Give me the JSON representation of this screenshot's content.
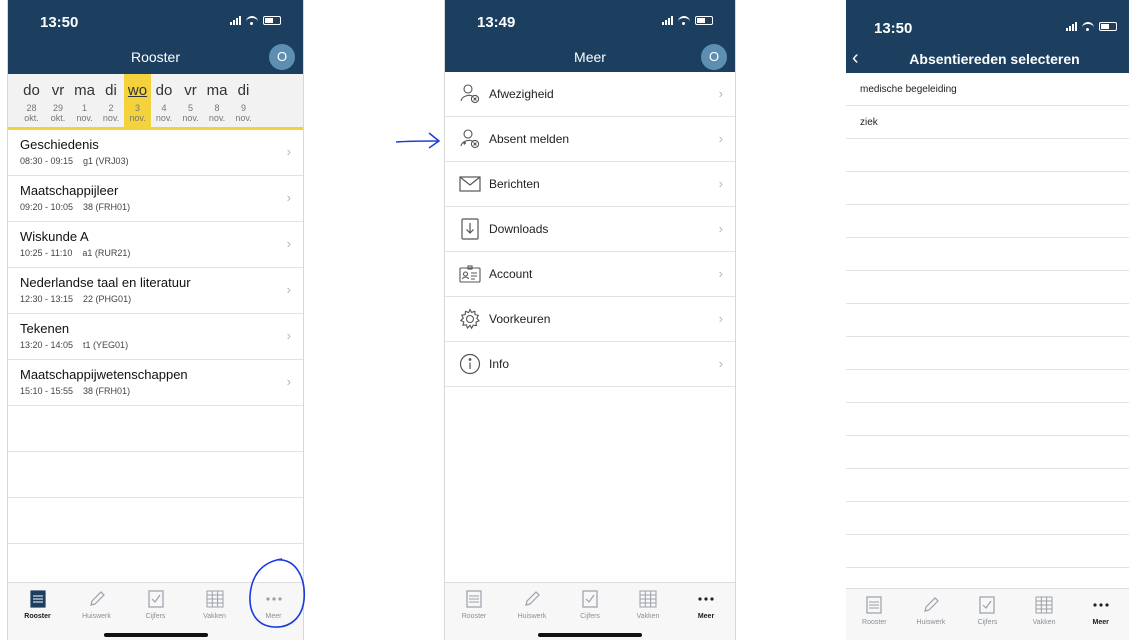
{
  "screens": {
    "rooster": {
      "time": "13:50",
      "title": "Rooster",
      "avatar": "O",
      "days": [
        {
          "name": "do",
          "date": "28",
          "month": "okt."
        },
        {
          "name": "vr",
          "date": "29",
          "month": "okt."
        },
        {
          "name": "ma",
          "date": "1",
          "month": "nov."
        },
        {
          "name": "di",
          "date": "2",
          "month": "nov."
        },
        {
          "name": "wo",
          "date": "3",
          "month": "nov."
        },
        {
          "name": "do",
          "date": "4",
          "month": "nov."
        },
        {
          "name": "vr",
          "date": "5",
          "month": "nov."
        },
        {
          "name": "ma",
          "date": "8",
          "month": "nov."
        },
        {
          "name": "di",
          "date": "9",
          "month": "nov."
        }
      ],
      "selected_day_index": 4,
      "lessons": [
        {
          "subject": "Geschiedenis",
          "time": "08:30 - 09:15",
          "room": "g1 (VRJ03)"
        },
        {
          "subject": "Maatschappijleer",
          "time": "09:20 - 10:05",
          "room": "38 (FRH01)"
        },
        {
          "subject": "Wiskunde A",
          "time": "10:25 - 11:10",
          "room": "a1 (RUR21)"
        },
        {
          "subject": "Nederlandse taal en literatuur",
          "time": "12:30 - 13:15",
          "room": "22 (PHG01)"
        },
        {
          "subject": "Tekenen",
          "time": "13:20 - 14:05",
          "room": "t1 (YEG01)"
        },
        {
          "subject": "Maatschappijwetenschappen",
          "time": "15:10 - 15:55",
          "room": "38 (FRH01)"
        }
      ],
      "tabs": [
        "Rooster",
        "Huiswerk",
        "Cijfers",
        "Vakken",
        "Meer"
      ],
      "active_tab": "Rooster"
    },
    "meer": {
      "time": "13:49",
      "title": "Meer",
      "avatar": "O",
      "items": [
        {
          "label": "Afwezigheid",
          "icon": "person-x-icon"
        },
        {
          "label": "Absent melden",
          "icon": "person-report-icon"
        },
        {
          "label": "Berichten",
          "icon": "envelope-icon"
        },
        {
          "label": "Downloads",
          "icon": "download-icon"
        },
        {
          "label": "Account",
          "icon": "id-card-icon"
        },
        {
          "label": "Voorkeuren",
          "icon": "gear-icon"
        },
        {
          "label": "Info",
          "icon": "info-icon"
        }
      ],
      "tabs": [
        "Rooster",
        "Huiswerk",
        "Cijfers",
        "Vakken",
        "Meer"
      ],
      "active_tab": "Meer"
    },
    "absentie": {
      "time": "13:50",
      "title": "Absentiereden selecteren",
      "options": [
        "medische begeleiding",
        "ziek"
      ],
      "tabs": [
        "Rooster",
        "Huiswerk",
        "Cijfers",
        "Vakken",
        "Meer"
      ],
      "active_tab": "Meer"
    }
  },
  "colors": {
    "header": "#1c3f60",
    "avatar": "#5d8fb3",
    "selected_day": "#f4d23c",
    "annotation": "#1a3be0"
  }
}
